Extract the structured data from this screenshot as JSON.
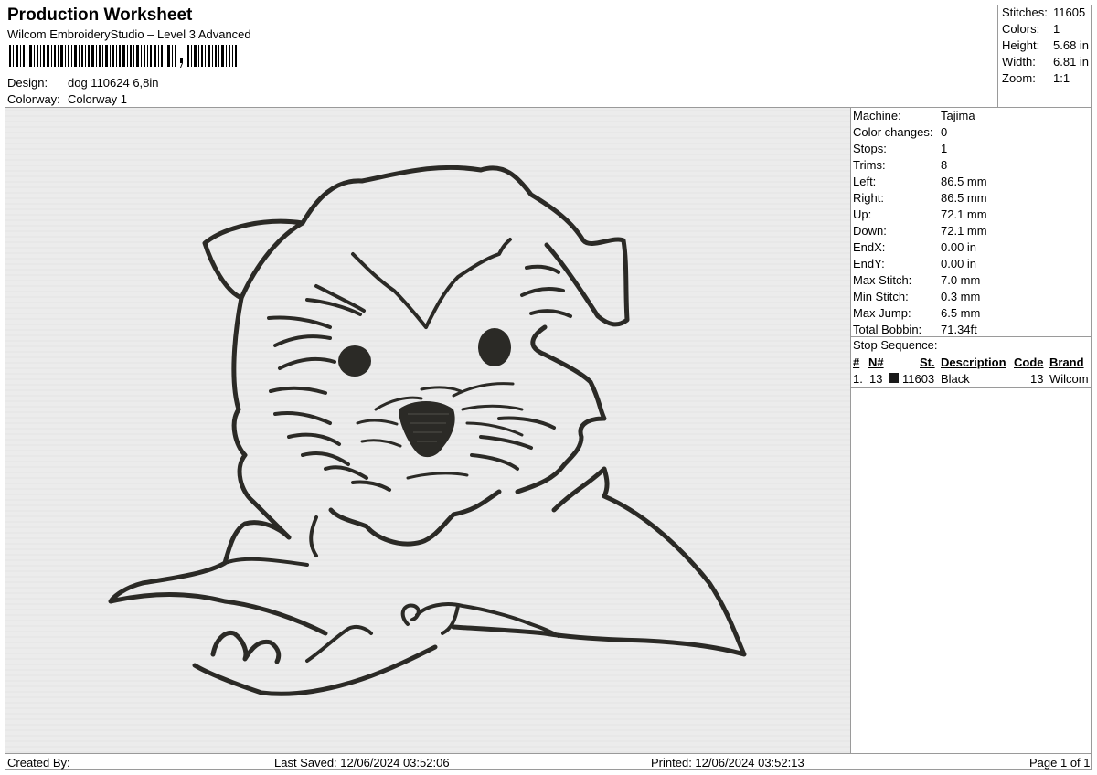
{
  "header": {
    "title": "Production Worksheet",
    "software": "Wilcom EmbroideryStudio – Level 3 Advanced",
    "design_label": "Design:",
    "design_value": "dog 110624 6,8in",
    "colorway_label": "Colorway:",
    "colorway_value": "Colorway 1"
  },
  "summary": {
    "stitches_label": "Stitches:",
    "stitches": "11605",
    "colors_label": "Colors:",
    "colors": "1",
    "height_label": "Height:",
    "height": "5.68 in",
    "width_label": "Width:",
    "width": "6.81 in",
    "zoom_label": "Zoom:",
    "zoom": "1:1"
  },
  "machine": [
    {
      "label": "Machine:",
      "value": "Tajima"
    },
    {
      "label": "Color changes:",
      "value": "0"
    },
    {
      "label": "Stops:",
      "value": "1"
    },
    {
      "label": "Trims:",
      "value": "8"
    },
    {
      "label": "Left:",
      "value": "86.5 mm"
    },
    {
      "label": "Right:",
      "value": "86.5 mm"
    },
    {
      "label": "Up:",
      "value": "72.1 mm"
    },
    {
      "label": "Down:",
      "value": "72.1 mm"
    },
    {
      "label": "EndX:",
      "value": "0.00 in"
    },
    {
      "label": "EndY:",
      "value": "0.00 in"
    },
    {
      "label": "Max Stitch:",
      "value": "7.0 mm"
    },
    {
      "label": "Min Stitch:",
      "value": "0.3 mm"
    },
    {
      "label": "Max Jump:",
      "value": "6.5 mm"
    },
    {
      "label": "Total Bobbin:",
      "value": "71.34ft"
    }
  ],
  "stop_sequence": {
    "title": "Stop Sequence:",
    "headers": {
      "num": "#",
      "n": "N#",
      "st": "St.",
      "description": "Description",
      "code": "Code",
      "brand": "Brand"
    },
    "rows": [
      {
        "num": "1.",
        "n": "13",
        "st": "11603",
        "description": "Black",
        "code": "13",
        "brand": "Wilcom",
        "color": "#1a1a1a"
      }
    ]
  },
  "footer": {
    "created_by": "Created By:",
    "last_saved": "Last Saved: 12/06/2024 03:52:06",
    "printed": "Printed: 12/06/2024 03:52:13",
    "page": "Page 1 of 1"
  },
  "design_colors": {
    "thread": "#2b2a26",
    "fabric": "#ececec"
  }
}
